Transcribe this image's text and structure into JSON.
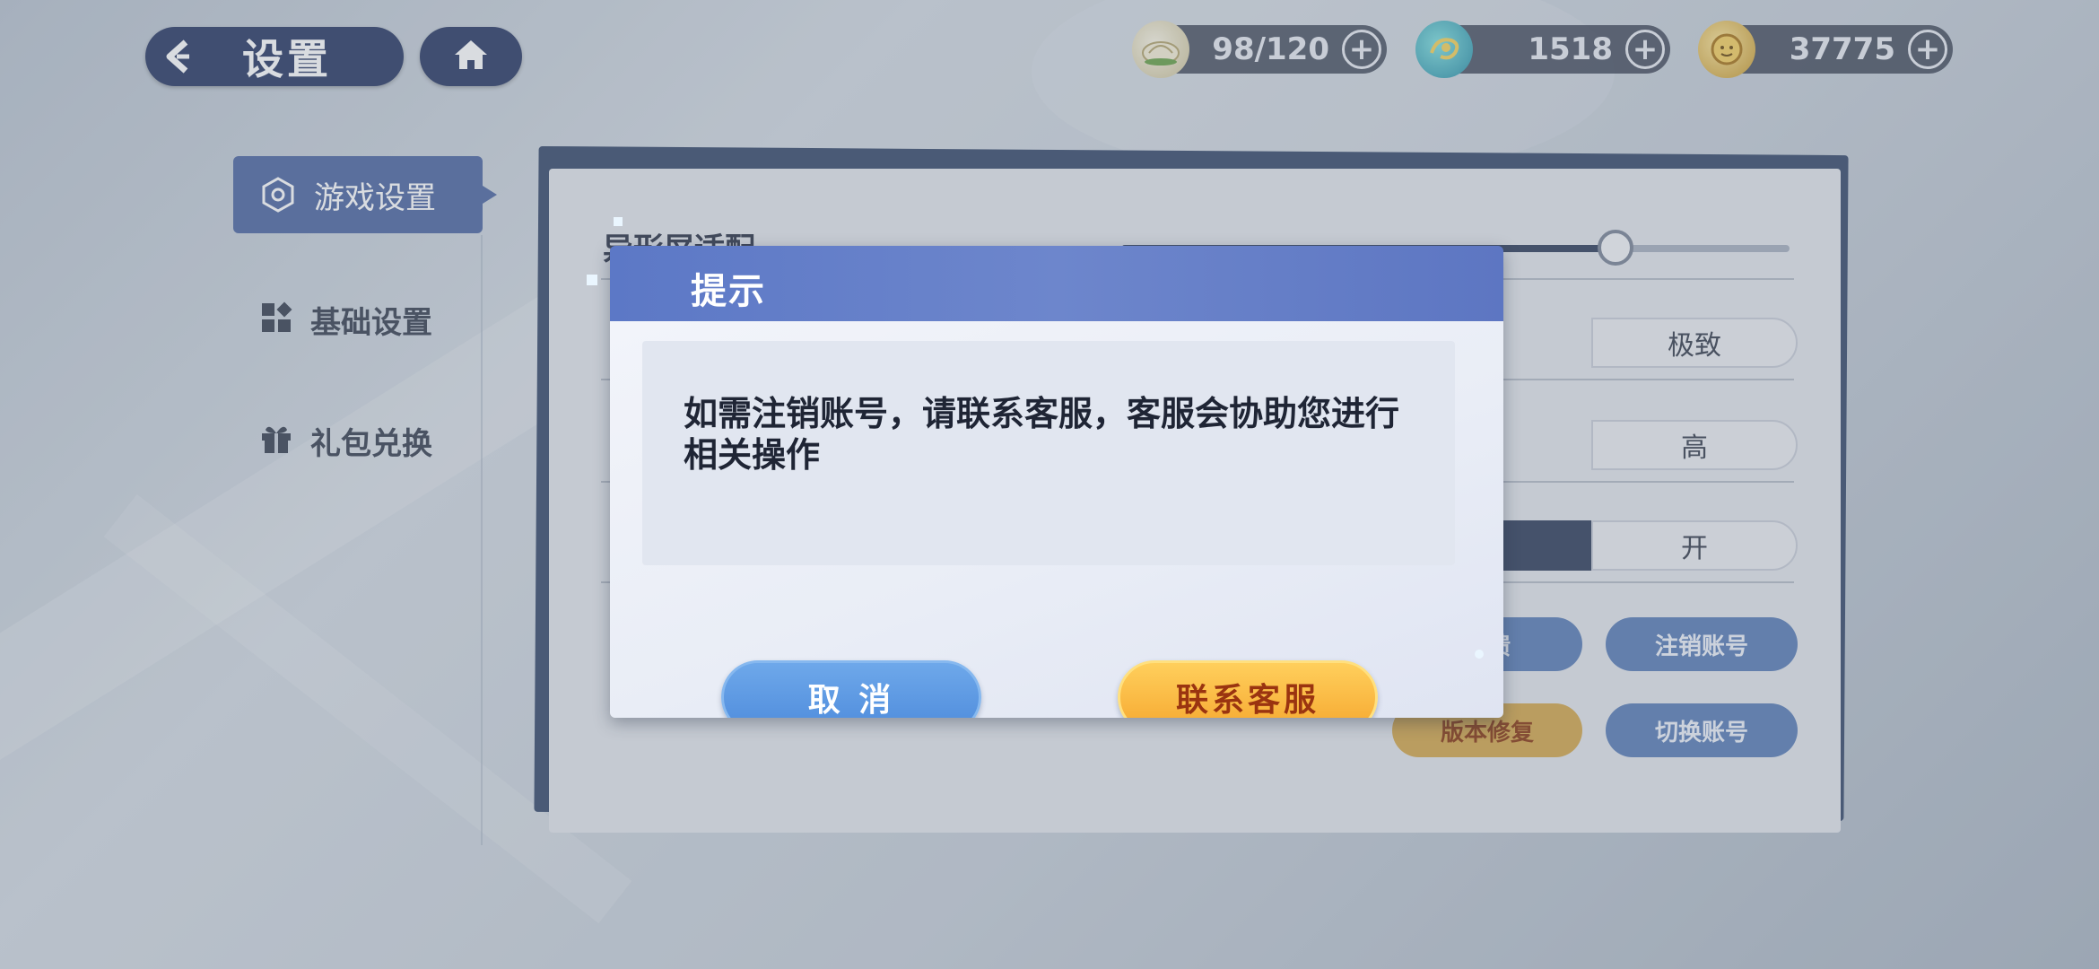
{
  "header": {
    "title": "设置"
  },
  "resources": [
    {
      "icon": "stamina-bun-icon",
      "value": "98/120"
    },
    {
      "icon": "gem-icon",
      "value": "1518"
    },
    {
      "icon": "coin-icon",
      "value": "37775"
    }
  ],
  "nav": {
    "items": [
      {
        "label": "游戏设置",
        "icon": "hexagon-gear-icon",
        "active": true
      },
      {
        "label": "基础设置",
        "icon": "blocks-icon"
      },
      {
        "label": "礼包兑换",
        "icon": "gift-icon"
      }
    ]
  },
  "settings": {
    "notch_label": "异形屏适配",
    "notch_slider": 0.74,
    "quality_option": "极致",
    "framerate_option": "高",
    "toggle_option": "开",
    "buttons": {
      "feedback_partial": "反馈",
      "deregister": "注销账号",
      "repair": "版本修复",
      "switch_account": "切换账号"
    }
  },
  "dialog": {
    "title": "提示",
    "message": "如需注销账号，请联系客服，客服会协助您进行相关操作",
    "cancel_label": "取 消",
    "confirm_label": "联系客服"
  }
}
